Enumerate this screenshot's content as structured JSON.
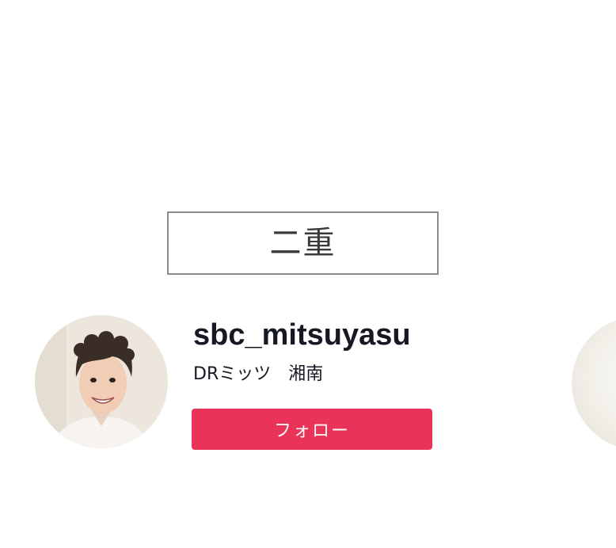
{
  "tag": {
    "label": "二重"
  },
  "account": {
    "username": "sbc_mitsuyasu",
    "display_name": "DRミッツ　湘南",
    "avatar_icon": "profile-photo",
    "follow_label": "フォロー"
  },
  "colors": {
    "follow_button": "#ea3358",
    "username_text": "#161823",
    "tag_border": "#8c8c8c"
  }
}
